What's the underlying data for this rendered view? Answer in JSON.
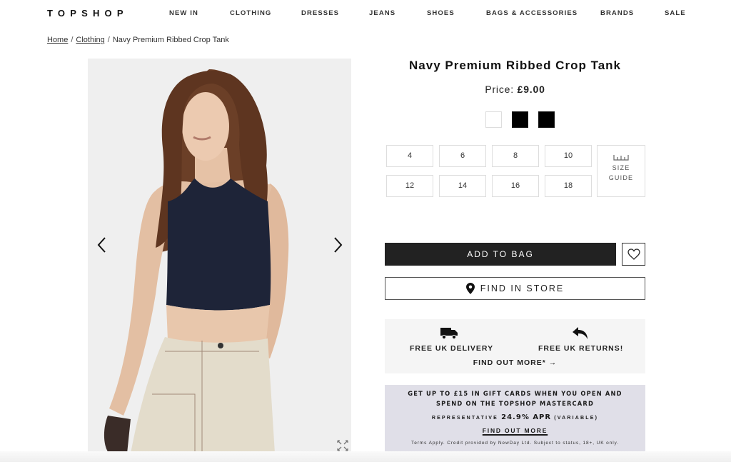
{
  "header": {
    "logo": "TOPSHOP",
    "nav": [
      "NEW IN",
      "CLOTHING",
      "DRESSES",
      "JEANS",
      "SHOES",
      "BAGS & ACCESSORIES",
      "BRANDS",
      "SALE"
    ]
  },
  "breadcrumb": {
    "items": [
      "Home",
      "Clothing"
    ],
    "current": "Navy Premium Ribbed Crop Tank",
    "separator": "/"
  },
  "gallery": {
    "prev_icon": "chevron-left-icon",
    "next_icon": "chevron-right-icon",
    "expand_icon": "expand-icon",
    "image_alt": "Model wearing navy ribbed crop tank with cream utility trousers"
  },
  "product": {
    "title": "Navy Premium Ribbed Crop Tank",
    "price_label": "Price:",
    "price": "£9.00",
    "swatches": [
      {
        "name": "white",
        "color": "#ffffff"
      },
      {
        "name": "black",
        "color": "#000000"
      },
      {
        "name": "black",
        "color": "#000000"
      }
    ],
    "sizes": [
      "4",
      "6",
      "8",
      "10",
      "12",
      "14",
      "16",
      "18"
    ],
    "size_guide": [
      "SIZE",
      "GUIDE"
    ],
    "add_to_bag": "ADD TO BAG",
    "find_in_store": "FIND IN STORE"
  },
  "delivery": {
    "delivery_label": "FREE UK DELIVERY",
    "returns_label": "FREE UK RETURNS!",
    "find_out_more": "FIND OUT MORE*  →"
  },
  "promo": {
    "headline_line1": "GET UP TO £15 IN GIFT CARDS WHEN YOU OPEN AND",
    "headline_line2": "SPEND ON THE TOPSHOP MASTERCARD",
    "apr_prefix": "REPRESENTATIVE",
    "apr_value": "24.9% APR",
    "apr_suffix": "(VARIABLE)",
    "link": "FIND OUT MORE",
    "terms": "Terms Apply. Credit provided by NewDay Ltd. Subject to status, 18+, UK only."
  },
  "colors": {
    "accent_dark": "#222222",
    "image_bg": "#efefef",
    "delivery_bg": "#f5f5f5",
    "promo_bg": "#e0dfe8"
  }
}
